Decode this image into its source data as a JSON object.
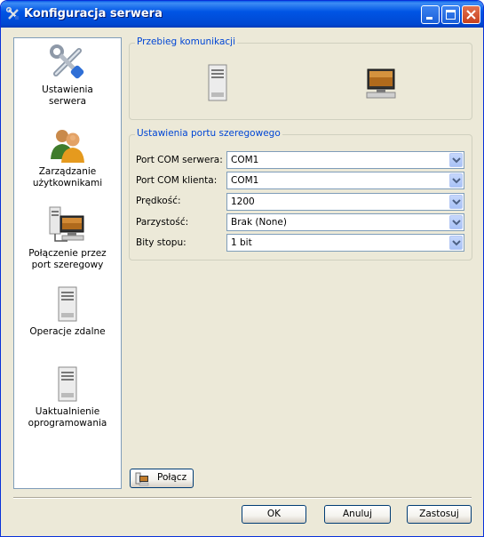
{
  "window": {
    "title": "Konfiguracja serwera"
  },
  "sidebar": {
    "items": [
      {
        "label_lines": [
          "Ustawienia",
          "serwera"
        ],
        "icon": "tools-icon"
      },
      {
        "label_lines": [
          "Zarządzanie",
          "użytkownikami"
        ],
        "icon": "users-icon"
      },
      {
        "label_lines": [
          "Połączenie przez",
          "port szeregowy"
        ],
        "icon": "serial-connection-icon"
      },
      {
        "label_lines": [
          "Operacje zdalne"
        ],
        "icon": "server-icon"
      },
      {
        "label_lines": [
          "Uaktualnienie",
          "oprogramowania"
        ],
        "icon": "server-update-icon"
      }
    ]
  },
  "communication": {
    "title": "Przebieg komunikacji"
  },
  "serial": {
    "title": "Ustawienia portu szeregowego",
    "fields": [
      {
        "label": "Port COM serwera:",
        "value": "COM1"
      },
      {
        "label": "Port COM klienta:",
        "value": "COM1"
      },
      {
        "label": "Prędkość:",
        "value": "1200"
      },
      {
        "label": "Parzystość:",
        "value": "Brak (None)"
      },
      {
        "label": "Bity stopu:",
        "value": "1 bit"
      }
    ]
  },
  "connect_button": {
    "label": "Połącz"
  },
  "footer": {
    "ok": "OK",
    "cancel": "Anuluj",
    "apply": "Zastosuj"
  }
}
